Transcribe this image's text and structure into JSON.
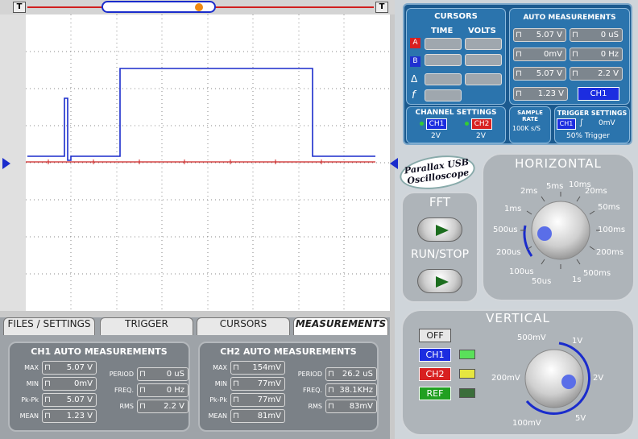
{
  "top_buttons": [
    "T",
    "T"
  ],
  "tabs": [
    {
      "label": "FILES / SETTINGS"
    },
    {
      "label": "TRIGGER"
    },
    {
      "label": "CURSORS"
    },
    {
      "label": "MEASUREMENTS"
    }
  ],
  "ch1_meas": {
    "title": "CH1 AUTO MEASUREMENTS",
    "left": [
      {
        "label": "MAX",
        "value": "5.07 V"
      },
      {
        "label": "MIN",
        "value": "0mV"
      },
      {
        "label": "Pk-Pk",
        "value": "5.07 V"
      },
      {
        "label": "MEAN",
        "value": "1.23 V"
      }
    ],
    "right": [
      {
        "label": "PERIOD",
        "value": "0 uS"
      },
      {
        "label": "FREQ.",
        "value": "0 Hz"
      },
      {
        "label": "RMS",
        "value": "2.2 V"
      }
    ]
  },
  "ch2_meas": {
    "title": "CH2 AUTO MEASUREMENTS",
    "left": [
      {
        "label": "MAX",
        "value": "154mV"
      },
      {
        "label": "MIN",
        "value": "77mV"
      },
      {
        "label": "Pk-Pk",
        "value": "77mV"
      },
      {
        "label": "MEAN",
        "value": "81mV"
      }
    ],
    "right": [
      {
        "label": "PERIOD",
        "value": "26.2 uS"
      },
      {
        "label": "FREQ.",
        "value": "38.1KHz"
      },
      {
        "label": "RMS",
        "value": "83mV"
      }
    ]
  },
  "cursors": {
    "title": "CURSORS",
    "time": "TIME",
    "volts": "VOLTS",
    "a": "A",
    "b": "B",
    "delta": "Δ",
    "f": "f"
  },
  "auto": {
    "title": "AUTO MEASUREMENTS",
    "values": [
      "5.07 V",
      "0 uS",
      "0mV",
      "0 Hz",
      "5.07 V",
      "2.2 V",
      "1.23 V"
    ],
    "channel": "CH1"
  },
  "channel_settings": {
    "title": "CHANNEL SETTINGS",
    "ch1": "CH1",
    "ch2": "CH2",
    "ch1_v": "2V",
    "ch2_v": "2V"
  },
  "sample_rate": {
    "title": "SAMPLE RATE",
    "value": "100K s/S"
  },
  "trigger_settings": {
    "title": "TRIGGER SETTINGS",
    "ch": "CH1",
    "level": "0mV",
    "mode": "50% Trigger"
  },
  "logo": {
    "l1": "Parallax USB",
    "l2": "Oscilloscope"
  },
  "fft": "FFT",
  "runstop": "RUN/STOP",
  "horizontal": {
    "title": "HORIZONTAL",
    "labels": [
      "5ms",
      "10ms",
      "20ms",
      "50ms",
      "100ms",
      "200ms",
      "500ms",
      "1s",
      "50us",
      "100us",
      "200us",
      "500us",
      "1ms",
      "2ms"
    ]
  },
  "vertical": {
    "title": "VERTICAL",
    "off": "OFF",
    "ch1": "CH1",
    "ch2": "CH2",
    "ref": "REF",
    "labels": [
      "500mV",
      "1V",
      "2V",
      "5V",
      "100mV",
      "200mV"
    ]
  },
  "colors": {
    "ch1": "#1a2ccc",
    "ch2": "#cc2222"
  }
}
